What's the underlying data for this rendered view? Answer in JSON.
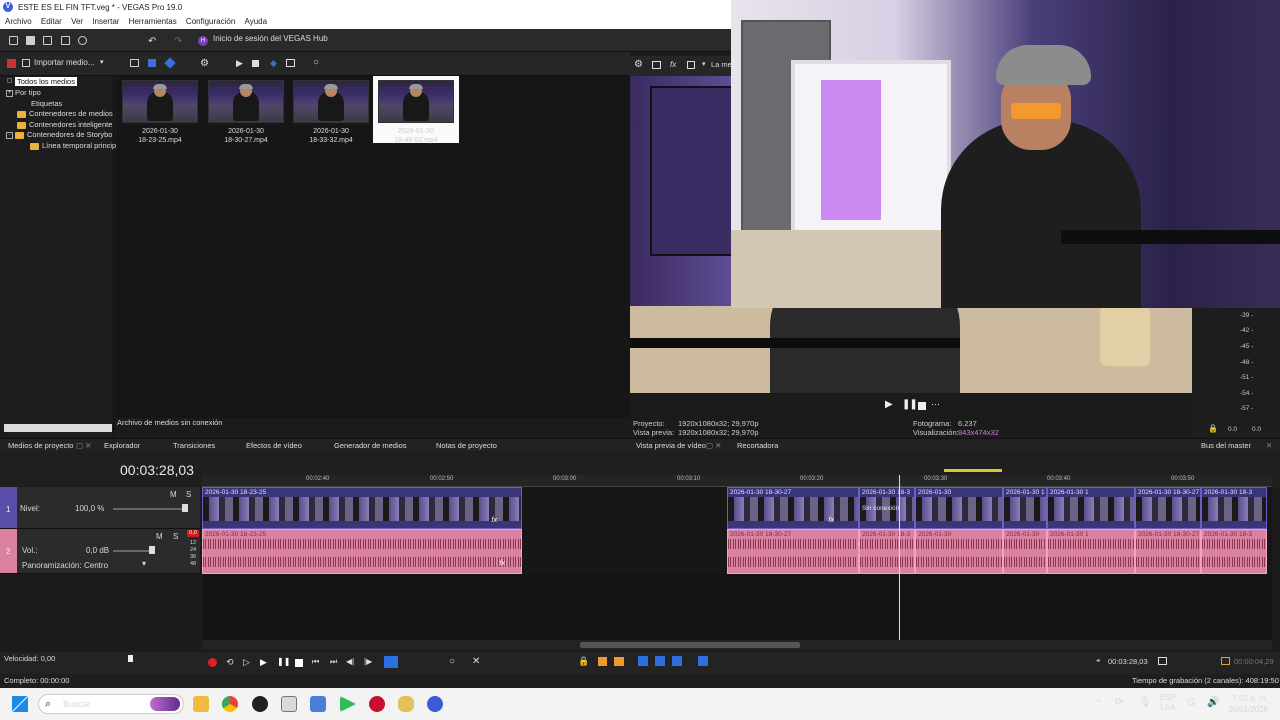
{
  "window": {
    "title": "ESTE ES EL FIN TFT.veg * - VEGAS Pro 19.0",
    "logo": "V"
  },
  "menu": [
    "Archivo",
    "Editar",
    "Ver",
    "Insertar",
    "Herramientas",
    "Configuración",
    "Ayuda"
  ],
  "toolbar": {
    "hub_label": "Inicio de sesión del VEGAS Hub",
    "import_label": "Importar medio...",
    "preview_dropdown": "La me"
  },
  "tree": {
    "items": [
      {
        "label": "Todos los medios",
        "kind": "selected"
      },
      {
        "label": "Por tipo",
        "kind": "expand"
      },
      {
        "label": "Etiquetas",
        "kind": "plain"
      },
      {
        "label": "Contenedores de medios",
        "kind": "folder"
      },
      {
        "label": "Contenedores inteligente",
        "kind": "folder"
      },
      {
        "label": "Contenedores de Storybo",
        "kind": "folder-expand"
      },
      {
        "label": "Línea temporal princip",
        "kind": "folder-sub"
      }
    ]
  },
  "media": {
    "items": [
      {
        "date": "2026-01-30",
        "file": "18-23-25.mp4"
      },
      {
        "date": "2026-01-30",
        "file": "18-30-27.mp4"
      },
      {
        "date": "2026-01-30",
        "file": "18-33-32.mp4"
      },
      {
        "date": "2026-01-30",
        "file": "18-49-02.mp4"
      }
    ],
    "status": "Archivo de medios sin conexión"
  },
  "preview": {
    "project_label": "Proyecto:",
    "project_value": "1920x1080x32; 29,970p",
    "vista_label": "Vista previa:",
    "vista_value": "1920x1080x32; 29,970p",
    "frame_label": "Fotograma:",
    "frame_value": "6.237",
    "vis_label": "Visualización:",
    "vis_value": "843x474x32"
  },
  "meter": {
    "labels": [
      "-39 -",
      "-42 -",
      "-45 -",
      "-48 -",
      "-51 -",
      "-54 -",
      "-57 -"
    ],
    "footer_left": "0.0",
    "footer_right": "0.0"
  },
  "tabs": {
    "left": [
      "Medios de proyecto",
      "Explorador",
      "Transiciones",
      "Efectos de vídeo",
      "Generador de medios",
      "Notas de proyecto"
    ],
    "right": [
      "Vista previa de vídeo",
      "Recortadora"
    ],
    "master": "Bus del master"
  },
  "timeline": {
    "timecode": "00:03:28,03",
    "ruler": [
      "00:02:40",
      "00:02:50",
      "00:03:00",
      "00:03:10",
      "00:03:20",
      "00:03:30",
      "00:03:40",
      "00:03:50"
    ],
    "video_track": {
      "num": "1",
      "level_label": "Nivel:",
      "level_value": "100,0 %",
      "m": "M",
      "s": "S"
    },
    "audio_track": {
      "num": "2",
      "vol_label": "Vol.:",
      "vol_value": "0,0 dB",
      "pan_label": "Panoramización:",
      "pan_value": "Centro",
      "m": "M",
      "s": "S",
      "meter_ticks": [
        "12",
        "24",
        "36",
        "48"
      ],
      "peak": "0,0"
    },
    "clips_video": [
      "2026-01-30 18-23-25",
      "2026-01-30 18-30-27",
      "2026-01-30 18-3",
      "2026-01-30",
      "2026-01-30 1",
      "2026-01-30 1",
      "2026-01-30 18-30-27",
      "2026-01-30 18-3"
    ],
    "clips_audio": [
      "2026-01-30 18-23-25",
      "2026-01-30 18-30-27",
      "2026-01-30 18-3",
      "2026-01-30",
      "2026-01-30",
      "2026-01-30 1",
      "2026-01-30 18-30-27",
      "2026-01-30 18-3"
    ],
    "offline_note": "Sin conexión",
    "fx": "fx"
  },
  "transport": {
    "speed": "Velocidad: 0,00",
    "end_time": "00:03:28,03",
    "end_time2": "00:00:04,29"
  },
  "status": {
    "left": "Completo: 00:00:00",
    "right": "Tiempo de grabación (2 canales): 408:19:50"
  },
  "taskbar": {
    "search": "Buscar",
    "lang1": "ESP",
    "lang2": "LAA",
    "time": "7:02 p. m.",
    "date": "30/01/2026"
  }
}
